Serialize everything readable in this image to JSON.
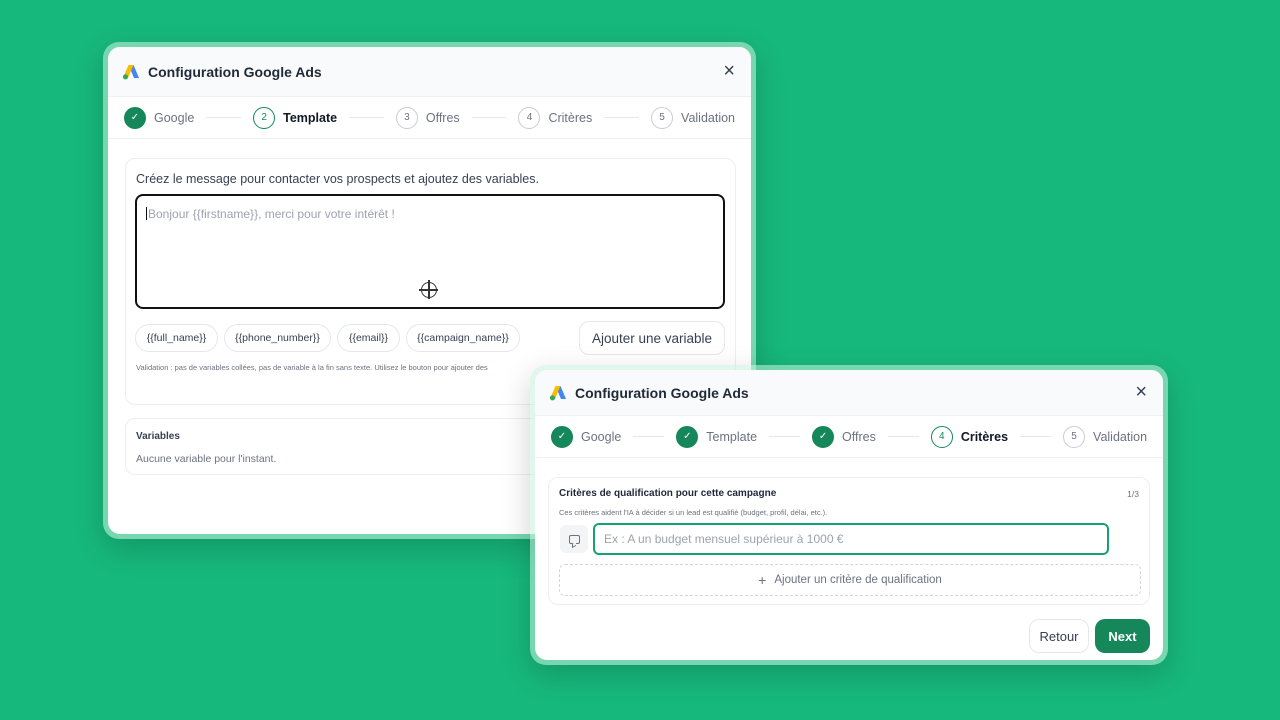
{
  "modal1": {
    "title": "Configuration Google Ads",
    "close": "×",
    "steps": [
      {
        "num": "✓",
        "label": "Google",
        "state": "done"
      },
      {
        "num": "2",
        "label": "Template",
        "state": "active"
      },
      {
        "num": "3",
        "label": "Offres",
        "state": "pending"
      },
      {
        "num": "4",
        "label": "Critères",
        "state": "pending"
      },
      {
        "num": "5",
        "label": "Validation",
        "state": "pending"
      }
    ],
    "intro": "Créez le message pour contacter vos prospects et ajoutez des variables.",
    "textarea_placeholder": "Bonjour {{firstname}}, merci pour votre intérêt !",
    "chips": [
      "{{full_name}}",
      "{{phone_number}}",
      "{{email}}",
      "{{campaign_name}}"
    ],
    "add_variable": "Ajouter une variable",
    "hint": "Validation : pas de variables collées, pas de variable à la fin sans texte. Utilisez le bouton pour ajouter des",
    "variables_title": "Variables",
    "variables_empty": "Aucune variable pour l'instant."
  },
  "modal2": {
    "title": "Configuration Google Ads",
    "close": "×",
    "steps": [
      {
        "num": "✓",
        "label": "Google",
        "state": "done"
      },
      {
        "num": "✓",
        "label": "Template",
        "state": "done"
      },
      {
        "num": "✓",
        "label": "Offres",
        "state": "done"
      },
      {
        "num": "4",
        "label": "Critères",
        "state": "active"
      },
      {
        "num": "5",
        "label": "Validation",
        "state": "pending"
      }
    ],
    "criteria_title": "Critères de qualification pour cette campagne",
    "criteria_count": "1/3",
    "criteria_desc": "Ces critères aident l'IA à décider si un lead est qualifié (budget, profil, délai, etc.).",
    "criteria_placeholder": "Ex : A un budget mensuel supérieur à 1000 €",
    "add_criteria": "Ajouter un critère de qualification",
    "add_icon": "+",
    "back": "Retour",
    "next": "Next"
  },
  "colors": {
    "background": "#17b87c",
    "accent": "#15875a"
  },
  "icons": {
    "logo": "google-ads-logo",
    "close": "close-icon",
    "check": "check-icon",
    "target": "crosshair-icon",
    "chat": "message-icon"
  }
}
